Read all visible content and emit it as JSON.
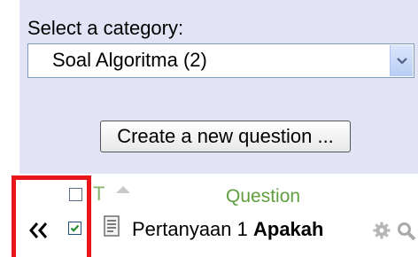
{
  "category": {
    "label": "Select a category:",
    "selected": "Soal Algoritma (2)",
    "dropdown_icon": "chevron-down-icon"
  },
  "create_button": {
    "label": "Create a new question ..."
  },
  "table": {
    "header": {
      "type_label": "T",
      "question_label": "Question",
      "sort_icon": "sort-ascending-icon"
    },
    "rows": [
      {
        "name": "Pertanyaan 1",
        "text_bold": "Apakah",
        "checked": true,
        "icons": [
          "document-icon",
          "gear-icon",
          "magnifier-icon"
        ]
      }
    ],
    "expand_icon": "double-chevron-left-icon"
  },
  "colors": {
    "panel_bg": "#e3e3f6",
    "highlight": "#e8151b",
    "column_header": "#5f9f3f"
  }
}
